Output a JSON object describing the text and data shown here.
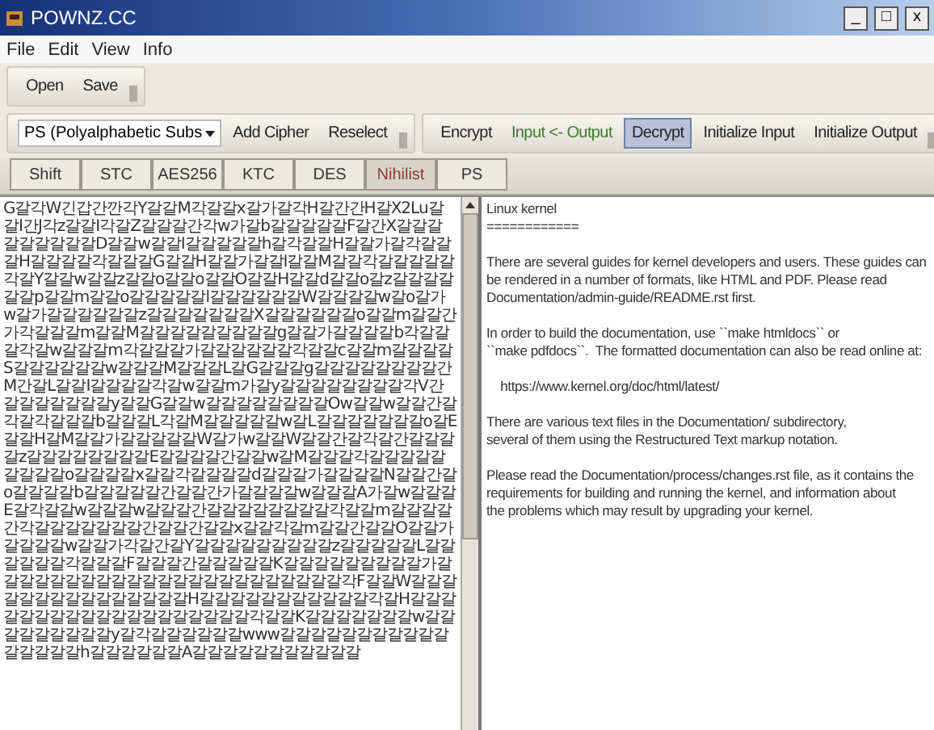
{
  "window": {
    "title": "POWNZ.CC",
    "controls": [
      "_",
      "□",
      "x"
    ]
  },
  "menu": [
    "File",
    "Edit",
    "View",
    "Info"
  ],
  "file_toolbar": [
    "Open",
    "Save"
  ],
  "cipher_toolbar": {
    "cipher_select": "PS (Polyalphabetic Subs",
    "buttons": [
      "Add Cipher",
      "Reselect"
    ]
  },
  "action_toolbar": [
    {
      "label": "Encrypt",
      "kind": "plain",
      "selected": false
    },
    {
      "label": "Input <- Output",
      "kind": "green",
      "selected": false
    },
    {
      "label": "Decrypt",
      "kind": "plain",
      "selected": true
    },
    {
      "label": "Initialize Input",
      "kind": "plain",
      "selected": false
    },
    {
      "label": "Initialize Output",
      "kind": "plain",
      "selected": false
    }
  ],
  "cipher_tabs": [
    {
      "label": "Shift",
      "selected": false
    },
    {
      "label": "STC",
      "selected": false
    },
    {
      "label": "AES256",
      "selected": false
    },
    {
      "label": "KTC",
      "selected": false
    },
    {
      "label": "DES",
      "selected": false
    },
    {
      "label": "Nihilist",
      "selected": true
    },
    {
      "label": "PS",
      "selected": false
    }
  ],
  "input_text": "G갈각W긴갑간깐각Y갈갈M각갈갈x갈가갈각H갈간간H갈X2Lu갈갈I간J각z갈갈I각갈Z갈갈갈간각w가갈b갈갈갈갈갈F갈간X갈갈갈갈갈갈갈갈갈D갈갈w갈갈I갈갈갈갈갈h갈각갈갈H갈갈가갈각갈갈갈H갈갈갈갈각갈갈갈G갈갈H갈갈가갈갈I갈갈M갈갈각갈갈갈갈갈각갈Y갈갈w갈갈z갈갈o갈갈o갈갈O갈갈H갈갈d갈갈o갈z갈갈갈갈갈갈p갈갈m갈갈o갈갈갈갈갈l갈갈갈갈갈갈W갈갈갈갈w갈o갈가w갈가갈갈갈갈갈갈z갈갈갈갈갈갈갈X갈갈갈갈갈갈o갈갈m갈갈간가각갈갈갈m갈갈M갈갈갈갈갈갈갈갈갈g갈갈가갈갈갈갈b각갈갈갈각갈w갈갈갈m각갈갈갈가갈갈갈갈갈갈각갈갈c갈갈m갈갈갈갈S갈갈갈갈갈갈w갈갈갈M갈갈갈L갈G갈갈갈g갈갈갈갈갈갈갈갈간M간갈L갈갈I갈갈갈갈각갈w갈갈m가갈y갈갈갈갈갈갈갈갈각V간갈갈갈갈갈갈갈y갈갈G갈갈w갈갈갈갈갈갈갈갈Ow갈갈w갈갈간갈각갈각갈갈갈b갈갈갈L각갈M갈갈갈갈갈w갈L갈갈갈갈갈갈갈o갈E갈갈H갈M갈갈가갈갈갈갈갈W갈가w갈갈W갈갈간갈각갈간갈갈갈갈z갈갈갈갈갈갈갈갈E갈갈갈갈간갈갈w갈M갈갈갈각갈갈갈갈갈갈갈갈갈o갈갈갈갈x갈갈각갈갈갈갈d갈갈갈가갈갈갈갈N갈갈간갈o갈갈갈갈b갈갈갈갈갈간갈갈간가갈갈갈갈w갈갈갈A가갈w갈갈갈E갈각갈갈w갈갈갈w갈갈갈간갈갈갈갈갈갈갈갈각갈갈m갈갈갈갈간각갈갈갈갈갈갈갈간갈갈간갈갈x갈갈각갈m갈갈간갈갈O갈갈가갈갈갈갈w갈갈가각갈간갈Y갈갈갈갈갈갈갈갈갈z갈갈갈갈갈L갈갈갈갈갈갈각갈갈갈F갈갈갈간갈갈갈갈갈K갈갈갈갈갈갈갈갈갈가갈갈갈갈갈갈갈갈갈갈갈갈갈갈갈갈갈갈갈갈갈갈갈각F갈갈W갈갈갈갈갈갈갈갈갈갈갈갈갈갈갈H갈갈갈갈갈갈갈갈갈갈갈각갈H갈갈갈갈갈갈갈갈갈갈갈갈갈갈갈갈갈갈갈각갈갈K갈갈갈갈갈갈갈w갈갈갈갈갈갈갈갈갈y갈각갈갈갈갈갈갈www갈갈갈갈갈갈갈갈갈갈갈갈갈갈갈갈h갈갈갈갈갈갈A갈갈갈갈갈갈갈갈갈갈갈",
  "output_text": [
    [
      "Linux kernel",
      "============"
    ],
    [
      "There are several guides for kernel developers and users. These guides can",
      "be rendered in a number of formats, like HTML and PDF. Please read",
      "Documentation/admin-guide/README.rst first."
    ],
    [
      "In order to build the documentation, use ``make htmldocs`` or",
      "``make pdfdocs``.  The formatted documentation can also be read online at:"
    ],
    [
      "    https://www.kernel.org/doc/html/latest/"
    ],
    [
      "There are various text files in the Documentation/ subdirectory,",
      "several of them using the Restructured Text markup notation."
    ],
    [
      "Please read the Documentation/process/changes.rst file, as it contains the",
      "requirements for building and running the kernel, and information about",
      "the problems which may result by upgrading your kernel."
    ]
  ]
}
